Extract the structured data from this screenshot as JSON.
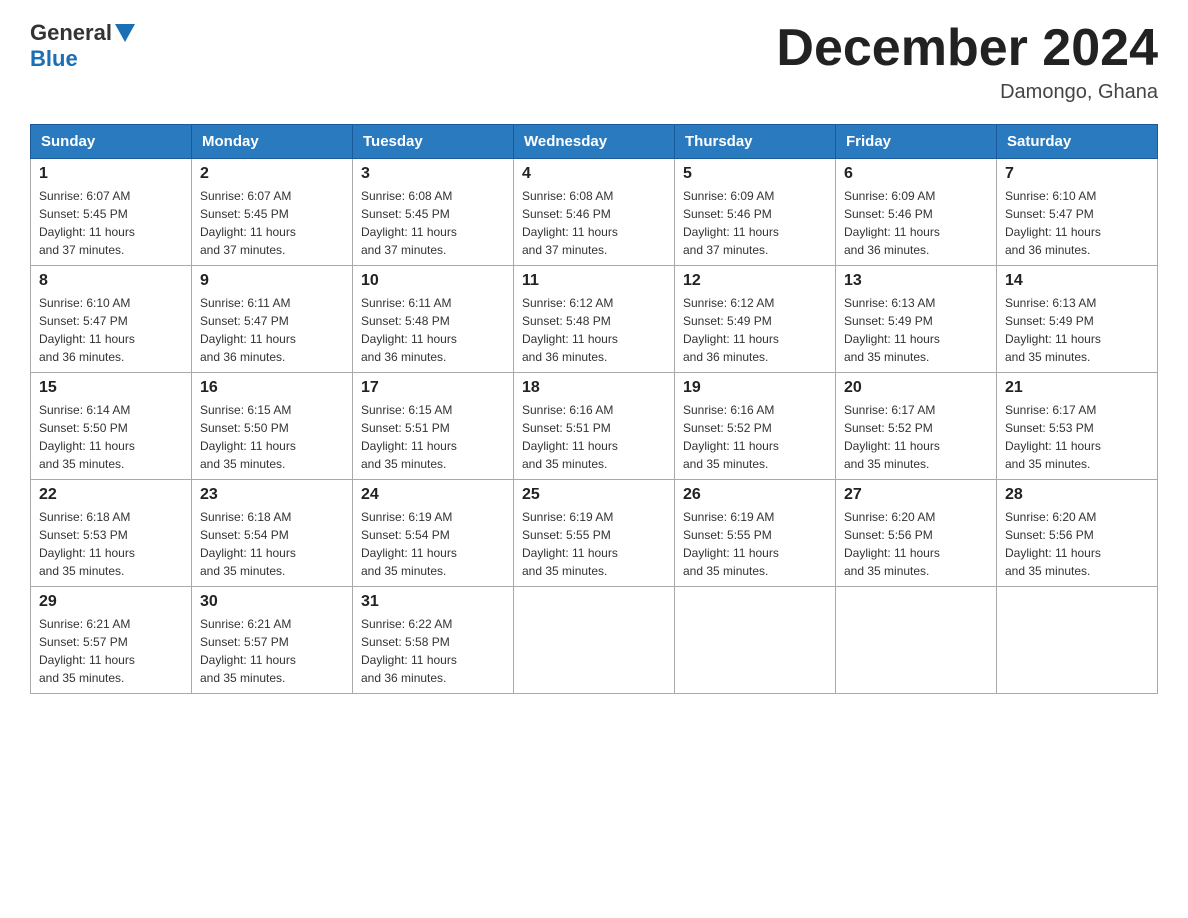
{
  "header": {
    "logo_general": "General",
    "logo_blue": "Blue",
    "month_title": "December 2024",
    "location": "Damongo, Ghana"
  },
  "weekdays": [
    "Sunday",
    "Monday",
    "Tuesday",
    "Wednesday",
    "Thursday",
    "Friday",
    "Saturday"
  ],
  "weeks": [
    [
      {
        "day": "1",
        "sunrise": "6:07 AM",
        "sunset": "5:45 PM",
        "daylight": "11 hours and 37 minutes."
      },
      {
        "day": "2",
        "sunrise": "6:07 AM",
        "sunset": "5:45 PM",
        "daylight": "11 hours and 37 minutes."
      },
      {
        "day": "3",
        "sunrise": "6:08 AM",
        "sunset": "5:45 PM",
        "daylight": "11 hours and 37 minutes."
      },
      {
        "day": "4",
        "sunrise": "6:08 AM",
        "sunset": "5:46 PM",
        "daylight": "11 hours and 37 minutes."
      },
      {
        "day": "5",
        "sunrise": "6:09 AM",
        "sunset": "5:46 PM",
        "daylight": "11 hours and 37 minutes."
      },
      {
        "day": "6",
        "sunrise": "6:09 AM",
        "sunset": "5:46 PM",
        "daylight": "11 hours and 36 minutes."
      },
      {
        "day": "7",
        "sunrise": "6:10 AM",
        "sunset": "5:47 PM",
        "daylight": "11 hours and 36 minutes."
      }
    ],
    [
      {
        "day": "8",
        "sunrise": "6:10 AM",
        "sunset": "5:47 PM",
        "daylight": "11 hours and 36 minutes."
      },
      {
        "day": "9",
        "sunrise": "6:11 AM",
        "sunset": "5:47 PM",
        "daylight": "11 hours and 36 minutes."
      },
      {
        "day": "10",
        "sunrise": "6:11 AM",
        "sunset": "5:48 PM",
        "daylight": "11 hours and 36 minutes."
      },
      {
        "day": "11",
        "sunrise": "6:12 AM",
        "sunset": "5:48 PM",
        "daylight": "11 hours and 36 minutes."
      },
      {
        "day": "12",
        "sunrise": "6:12 AM",
        "sunset": "5:49 PM",
        "daylight": "11 hours and 36 minutes."
      },
      {
        "day": "13",
        "sunrise": "6:13 AM",
        "sunset": "5:49 PM",
        "daylight": "11 hours and 35 minutes."
      },
      {
        "day": "14",
        "sunrise": "6:13 AM",
        "sunset": "5:49 PM",
        "daylight": "11 hours and 35 minutes."
      }
    ],
    [
      {
        "day": "15",
        "sunrise": "6:14 AM",
        "sunset": "5:50 PM",
        "daylight": "11 hours and 35 minutes."
      },
      {
        "day": "16",
        "sunrise": "6:15 AM",
        "sunset": "5:50 PM",
        "daylight": "11 hours and 35 minutes."
      },
      {
        "day": "17",
        "sunrise": "6:15 AM",
        "sunset": "5:51 PM",
        "daylight": "11 hours and 35 minutes."
      },
      {
        "day": "18",
        "sunrise": "6:16 AM",
        "sunset": "5:51 PM",
        "daylight": "11 hours and 35 minutes."
      },
      {
        "day": "19",
        "sunrise": "6:16 AM",
        "sunset": "5:52 PM",
        "daylight": "11 hours and 35 minutes."
      },
      {
        "day": "20",
        "sunrise": "6:17 AM",
        "sunset": "5:52 PM",
        "daylight": "11 hours and 35 minutes."
      },
      {
        "day": "21",
        "sunrise": "6:17 AM",
        "sunset": "5:53 PM",
        "daylight": "11 hours and 35 minutes."
      }
    ],
    [
      {
        "day": "22",
        "sunrise": "6:18 AM",
        "sunset": "5:53 PM",
        "daylight": "11 hours and 35 minutes."
      },
      {
        "day": "23",
        "sunrise": "6:18 AM",
        "sunset": "5:54 PM",
        "daylight": "11 hours and 35 minutes."
      },
      {
        "day": "24",
        "sunrise": "6:19 AM",
        "sunset": "5:54 PM",
        "daylight": "11 hours and 35 minutes."
      },
      {
        "day": "25",
        "sunrise": "6:19 AM",
        "sunset": "5:55 PM",
        "daylight": "11 hours and 35 minutes."
      },
      {
        "day": "26",
        "sunrise": "6:19 AM",
        "sunset": "5:55 PM",
        "daylight": "11 hours and 35 minutes."
      },
      {
        "day": "27",
        "sunrise": "6:20 AM",
        "sunset": "5:56 PM",
        "daylight": "11 hours and 35 minutes."
      },
      {
        "day": "28",
        "sunrise": "6:20 AM",
        "sunset": "5:56 PM",
        "daylight": "11 hours and 35 minutes."
      }
    ],
    [
      {
        "day": "29",
        "sunrise": "6:21 AM",
        "sunset": "5:57 PM",
        "daylight": "11 hours and 35 minutes."
      },
      {
        "day": "30",
        "sunrise": "6:21 AM",
        "sunset": "5:57 PM",
        "daylight": "11 hours and 35 minutes."
      },
      {
        "day": "31",
        "sunrise": "6:22 AM",
        "sunset": "5:58 PM",
        "daylight": "11 hours and 36 minutes."
      },
      null,
      null,
      null,
      null
    ]
  ],
  "labels": {
    "sunrise": "Sunrise:",
    "sunset": "Sunset:",
    "daylight": "Daylight:"
  }
}
